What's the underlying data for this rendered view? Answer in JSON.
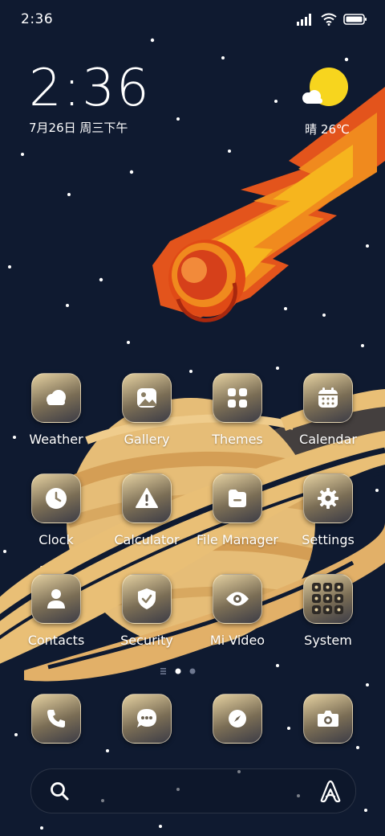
{
  "status_bar": {
    "time": "2:36"
  },
  "clock_widget": {
    "time": "2:36",
    "date": "7月26日 周三下午"
  },
  "weather_widget": {
    "text": "晴 26℃"
  },
  "apps": [
    {
      "label": "Weather",
      "icon": "weather-icon"
    },
    {
      "label": "Gallery",
      "icon": "gallery-icon"
    },
    {
      "label": "Themes",
      "icon": "themes-icon"
    },
    {
      "label": "Calendar",
      "icon": "calendar-icon"
    },
    {
      "label": "Clock",
      "icon": "clock-icon"
    },
    {
      "label": "Calculator",
      "icon": "calculator-icon"
    },
    {
      "label": "File Manager",
      "icon": "file-manager-icon"
    },
    {
      "label": "Settings",
      "icon": "settings-icon"
    },
    {
      "label": "Contacts",
      "icon": "contacts-icon"
    },
    {
      "label": "Security",
      "icon": "security-icon"
    },
    {
      "label": "Mi Video",
      "icon": "mi-video-icon"
    },
    {
      "label": "System",
      "icon": "system-folder-icon"
    }
  ],
  "dock": [
    {
      "icon": "phone-icon"
    },
    {
      "icon": "messages-icon"
    },
    {
      "icon": "browser-icon"
    },
    {
      "icon": "camera-icon"
    }
  ],
  "pager": {
    "pages": 2,
    "current": 1
  },
  "colors": {
    "background": "#0f1a30",
    "sun": "#f7d51e",
    "planet": "#e8bf78",
    "comet": "#f06a1a"
  }
}
